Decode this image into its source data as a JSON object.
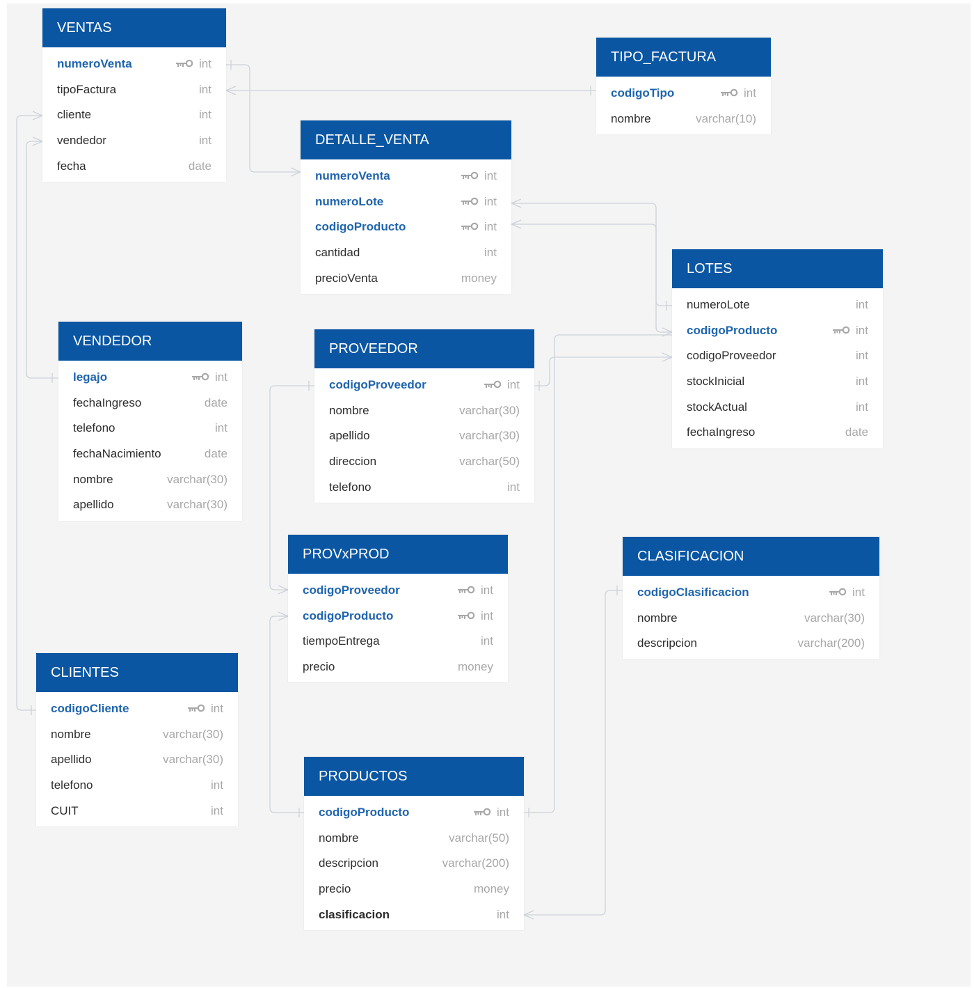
{
  "colors": {
    "header": "#0a56a3",
    "pk_text": "#1f64ad",
    "type_text": "#a8a8a8",
    "link": "#ccd2da",
    "canvas": "#f4f4f4"
  },
  "key_icon": "key-icon",
  "tables": {
    "ventas": {
      "name": "VENTAS",
      "fields": [
        {
          "name": "numeroVenta",
          "type": "int",
          "pk": true
        },
        {
          "name": "tipoFactura",
          "type": "int",
          "pk": false
        },
        {
          "name": "cliente",
          "type": "int",
          "pk": false
        },
        {
          "name": "vendedor",
          "type": "int",
          "pk": false
        },
        {
          "name": "fecha",
          "type": "date",
          "pk": false
        }
      ]
    },
    "tipo_factura": {
      "name": "TIPO_FACTURA",
      "fields": [
        {
          "name": "codigoTipo",
          "type": "int",
          "pk": true
        },
        {
          "name": "nombre",
          "type": "varchar(10)",
          "pk": false
        }
      ]
    },
    "detalle_venta": {
      "name": "DETALLE_VENTA",
      "fields": [
        {
          "name": "numeroVenta",
          "type": "int",
          "pk": true
        },
        {
          "name": "numeroLote",
          "type": "int",
          "pk": true
        },
        {
          "name": "codigoProducto",
          "type": "int",
          "pk": true
        },
        {
          "name": "cantidad",
          "type": "int",
          "pk": false
        },
        {
          "name": "precioVenta",
          "type": "money",
          "pk": false
        }
      ]
    },
    "lotes": {
      "name": "LOTES",
      "fields": [
        {
          "name": "numeroLote",
          "type": "int",
          "pk": false
        },
        {
          "name": "codigoProducto",
          "type": "int",
          "pk": true
        },
        {
          "name": "codigoProveedor",
          "type": "int",
          "pk": false
        },
        {
          "name": "stockInicial",
          "type": "int",
          "pk": false
        },
        {
          "name": "stockActual",
          "type": "int",
          "pk": false
        },
        {
          "name": "fechaIngreso",
          "type": "date",
          "pk": false
        }
      ]
    },
    "vendedor": {
      "name": "VENDEDOR",
      "fields": [
        {
          "name": "legajo",
          "type": "int",
          "pk": true
        },
        {
          "name": "fechaIngreso",
          "type": "date",
          "pk": false
        },
        {
          "name": "telefono",
          "type": "int",
          "pk": false
        },
        {
          "name": "fechaNacimiento",
          "type": "date",
          "pk": false
        },
        {
          "name": "nombre",
          "type": "varchar(30)",
          "pk": false
        },
        {
          "name": "apellido",
          "type": "varchar(30)",
          "pk": false
        }
      ]
    },
    "proveedor": {
      "name": "PROVEEDOR",
      "fields": [
        {
          "name": "codigoProveedor",
          "type": "int",
          "pk": true
        },
        {
          "name": "nombre",
          "type": "varchar(30)",
          "pk": false
        },
        {
          "name": "apellido",
          "type": "varchar(30)",
          "pk": false
        },
        {
          "name": "direccion",
          "type": "varchar(50)",
          "pk": false
        },
        {
          "name": "telefono",
          "type": "int",
          "pk": false
        }
      ]
    },
    "provxprod": {
      "name": "PROVxPROD",
      "fields": [
        {
          "name": "codigoProveedor",
          "type": "int",
          "pk": true
        },
        {
          "name": "codigoProducto",
          "type": "int",
          "pk": true
        },
        {
          "name": "tiempoEntrega",
          "type": "int",
          "pk": false
        },
        {
          "name": "precio",
          "type": "money",
          "pk": false
        }
      ]
    },
    "clasificacion": {
      "name": "CLASIFICACION",
      "fields": [
        {
          "name": "codigoClasificacion",
          "type": "int",
          "pk": true
        },
        {
          "name": "nombre",
          "type": "varchar(30)",
          "pk": false
        },
        {
          "name": "descripcion",
          "type": "varchar(200)",
          "pk": false
        }
      ]
    },
    "clientes": {
      "name": "CLIENTES",
      "fields": [
        {
          "name": "codigoCliente",
          "type": "int",
          "pk": true
        },
        {
          "name": "nombre",
          "type": "varchar(30)",
          "pk": false
        },
        {
          "name": "apellido",
          "type": "varchar(30)",
          "pk": false
        },
        {
          "name": "telefono",
          "type": "int",
          "pk": false
        },
        {
          "name": "CUIT",
          "type": "int",
          "pk": false
        }
      ]
    },
    "productos": {
      "name": "PRODUCTOS",
      "fields": [
        {
          "name": "codigoProducto",
          "type": "int",
          "pk": true
        },
        {
          "name": "nombre",
          "type": "varchar(50)",
          "pk": false
        },
        {
          "name": "descripcion",
          "type": "varchar(200)",
          "pk": false
        },
        {
          "name": "precio",
          "type": "money",
          "pk": false
        },
        {
          "name": "clasificacion",
          "type": "int",
          "pk": false,
          "bold": true
        }
      ]
    }
  }
}
